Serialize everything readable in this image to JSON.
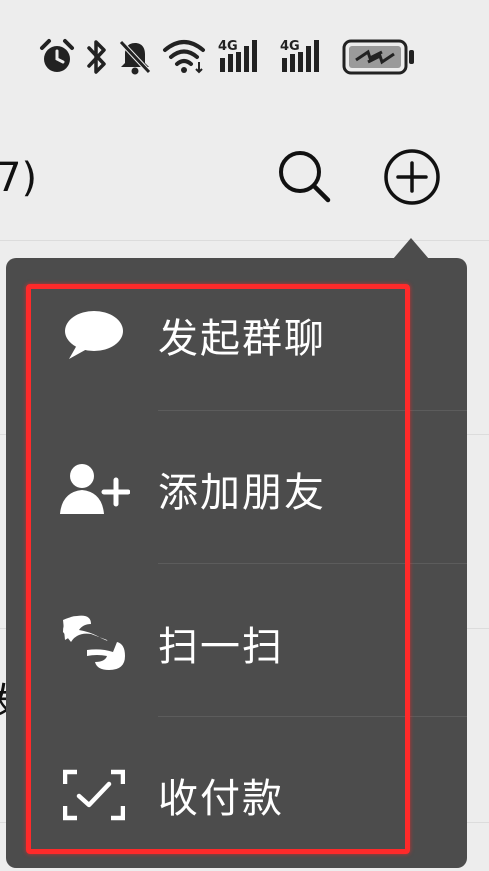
{
  "header": {
    "title_fragment": "7)"
  },
  "popup_menu": {
    "items": [
      {
        "label": "发起群聊",
        "icon": "chat-bubble-icon"
      },
      {
        "label": "添加朋友",
        "icon": "add-friend-icon"
      },
      {
        "label": "扫一扫",
        "icon": "scan-icon"
      },
      {
        "label": "收付款",
        "icon": "payment-scan-icon"
      }
    ]
  },
  "background": {
    "peek_char": "发"
  },
  "colors": {
    "background": "#ededed",
    "popup": "#4c4c4c",
    "highlight": "#ff2a2a",
    "text_light": "#ffffff",
    "text_dark": "#111111"
  }
}
